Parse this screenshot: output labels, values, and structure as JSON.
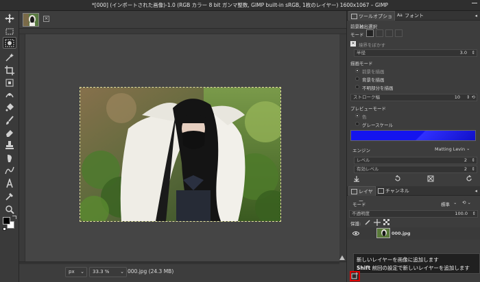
{
  "window": {
    "title": "*[000] (インポートされた画像)-1.0 (RGB カラー 8 bit ガンマ整数, GIMP built-in sRGB, 1枚のレイヤー) 1600x1067 – GIMP"
  },
  "toolbox": {
    "tools": [
      "move-tool",
      "rect-select-tool",
      "foreground-select-tool",
      "fuzzy-select-tool",
      "crop-tool",
      "unified-transform-tool",
      "warp-transform-tool",
      "bucket-fill-tool",
      "paintbrush-tool",
      "eraser-tool",
      "clone-tool",
      "smudge-tool",
      "path-tool",
      "text-tool",
      "color-picker-tool",
      "zoom-tool"
    ],
    "active_tool": "foreground-select-tool",
    "fg_color": "#000000",
    "bg_color": "#ffffff"
  },
  "statusbar": {
    "unit": "px",
    "zoom": "33.3 %",
    "file_info": "000.jpg (24.3 MB)"
  },
  "tool_options": {
    "tabs": [
      "ツールオプション",
      "フォント"
    ],
    "title": "前景抽出選択",
    "mode_label": "モード",
    "feather_label": "境界をぼかす",
    "radius_label": "半径",
    "radius_value": "3.0",
    "draw_mode_label": "描画モード",
    "draw_modes": [
      "前景を描画",
      "背景を描画",
      "不明部分を描画"
    ],
    "stroke_label": "ストローク幅",
    "stroke_value": "10",
    "preview_mode_label": "プレビューモード",
    "preview_modes": [
      "色",
      "グレースケール"
    ],
    "preview_color": "#1010e8",
    "engine_label": "エンジン",
    "engine_value": "Matting Levin",
    "levels_label": "レベル",
    "levels_value": "2",
    "active_levels_label": "有効レベル",
    "active_levels_value": "2"
  },
  "layers": {
    "tabs": [
      "レイヤー",
      "チャンネル"
    ],
    "mode_label": "モード",
    "mode_value": "標準",
    "opacity_label": "不透明度",
    "opacity_value": "100.0",
    "lock_label": "保護:",
    "items": [
      {
        "name": "000.jpg"
      }
    ]
  },
  "tooltip": {
    "line1": "新しいレイヤーを画像に追加します",
    "key": "Shift",
    "line2": "前回の設定で新しいレイヤーを追加します"
  }
}
